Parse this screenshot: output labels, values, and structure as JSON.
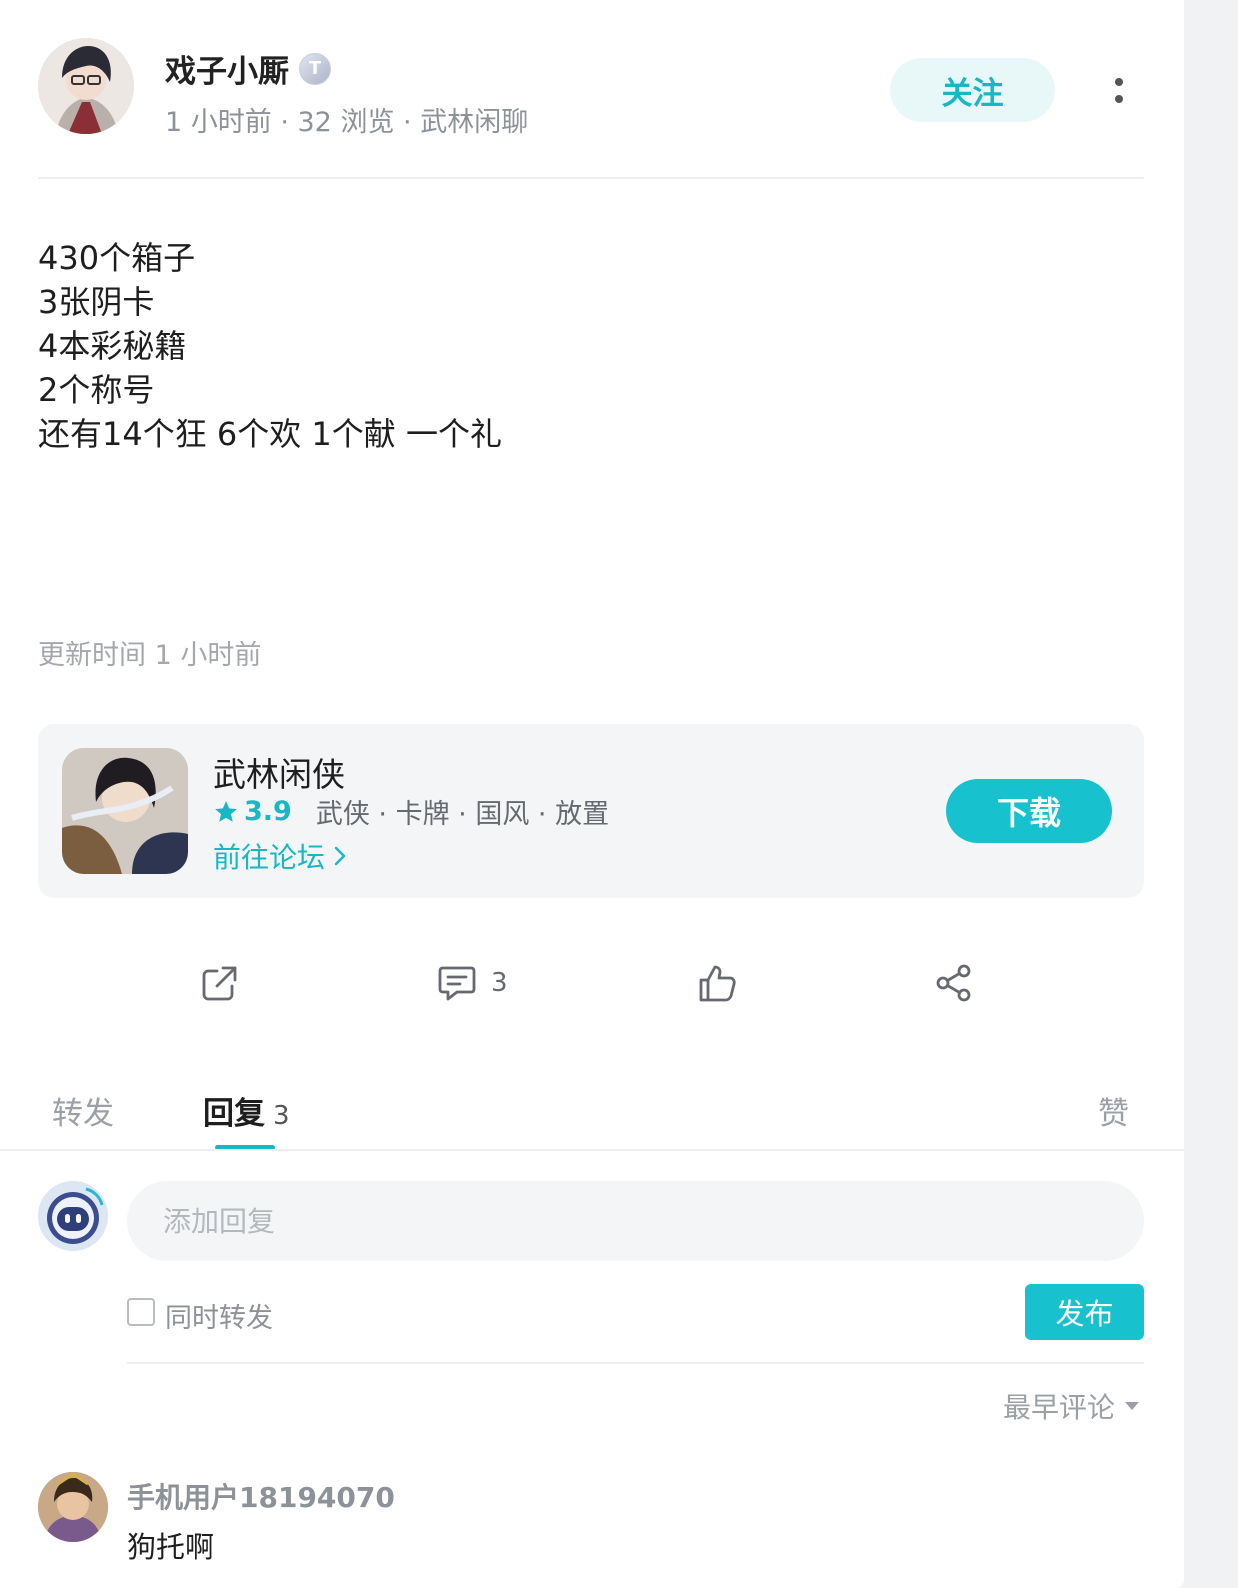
{
  "post": {
    "author": "戏子小厮",
    "author_badge": "T",
    "meta": "1 小时前 · 32 浏览 · 武林闲聊",
    "follow_label": "关注",
    "content_lines": [
      "430个箱子",
      "3张阴卡",
      "4本彩秘籍",
      "2个称号",
      "还有14个狂 6个欢 1个献 一个礼"
    ],
    "update_time": "更新时间 1 小时前"
  },
  "game": {
    "name": "武林闲侠",
    "rating": "3.9",
    "tags": "武侠 · 卡牌 · 国风 · 放置",
    "forum_link": "前往论坛",
    "download_label": "下载"
  },
  "actions": {
    "comment_count": "3"
  },
  "tabs": {
    "repost": "转发",
    "reply": "回复",
    "reply_count": "3",
    "like": "赞"
  },
  "composer": {
    "placeholder": "添加回复",
    "also_repost": "同时转发",
    "publish": "发布"
  },
  "sort": {
    "label": "最早评论"
  },
  "comments": [
    {
      "user": "手机用户18194070",
      "text": "狗托啊"
    }
  ],
  "colors": {
    "accent": "#17c1cd",
    "accent_text": "#17b8c4",
    "follow_bg": "#e8f8f9"
  }
}
